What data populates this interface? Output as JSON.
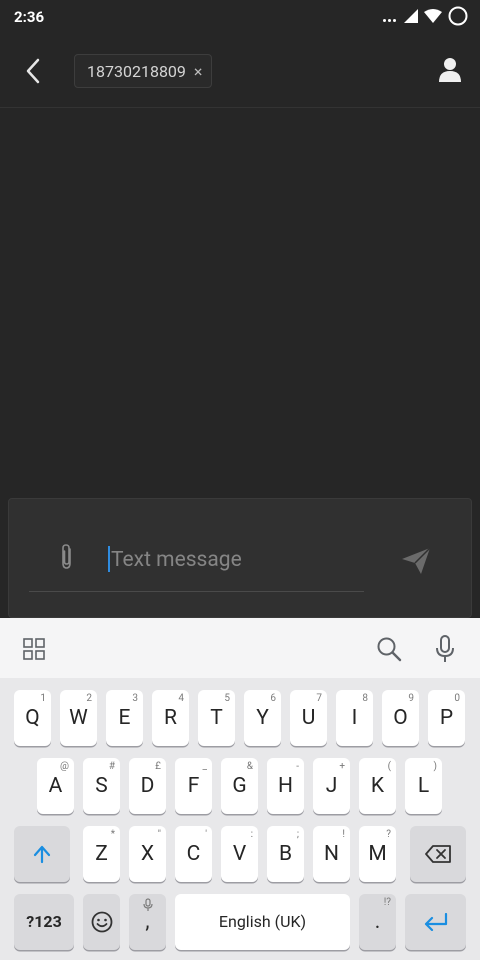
{
  "status_bar": {
    "time": "2:36"
  },
  "header": {
    "recipient_chip": {
      "text": "18730218809",
      "remove_symbol": "×"
    },
    "icons": [
      "back-arrow-icon",
      "contact-person-icon"
    ]
  },
  "composer": {
    "placeholder": "Text message",
    "icons": [
      "attachment-clip-icon",
      "send-icon"
    ]
  },
  "keyboard": {
    "toolbar_icons": [
      "apps-grid-icon",
      "search-icon",
      "microphone-icon"
    ],
    "row1": [
      {
        "label": "Q",
        "hint": "1"
      },
      {
        "label": "W",
        "hint": "2"
      },
      {
        "label": "E",
        "hint": "3"
      },
      {
        "label": "R",
        "hint": "4"
      },
      {
        "label": "T",
        "hint": "5"
      },
      {
        "label": "Y",
        "hint": "6"
      },
      {
        "label": "U",
        "hint": "7"
      },
      {
        "label": "I",
        "hint": "8"
      },
      {
        "label": "O",
        "hint": "9"
      },
      {
        "label": "P",
        "hint": "0"
      }
    ],
    "row2": [
      {
        "label": "A",
        "hint": "@"
      },
      {
        "label": "S",
        "hint": "#"
      },
      {
        "label": "D",
        "hint": "£"
      },
      {
        "label": "F",
        "hint": "_"
      },
      {
        "label": "G",
        "hint": "&"
      },
      {
        "label": "H",
        "hint": "-"
      },
      {
        "label": "J",
        "hint": "+"
      },
      {
        "label": "K",
        "hint": "("
      },
      {
        "label": "L",
        "hint": ")"
      }
    ],
    "row3": [
      {
        "label": "Z",
        "hint": "*"
      },
      {
        "label": "X",
        "hint": "\""
      },
      {
        "label": "C",
        "hint": "'"
      },
      {
        "label": "V",
        "hint": ":"
      },
      {
        "label": "B",
        "hint": ";"
      },
      {
        "label": "N",
        "hint": "!"
      },
      {
        "label": "M",
        "hint": "?"
      }
    ],
    "symbols_label": "?123",
    "comma_label": ",",
    "space_label": "English (UK)",
    "period_label": ".",
    "period_hint": "!?",
    "accent_color": "#1a8ee1"
  }
}
